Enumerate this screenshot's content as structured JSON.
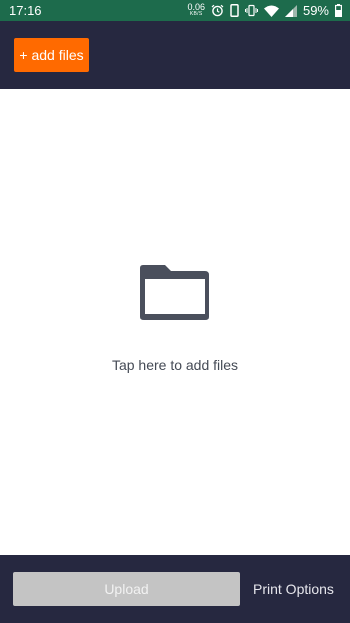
{
  "status_bar": {
    "time": "17:16",
    "net_speed_value": "0.06",
    "net_speed_unit": "KB/S",
    "battery_percent": "59%",
    "icons": [
      "alarm-icon",
      "phone-icon",
      "vibrate-icon",
      "wifi-icon",
      "signal-icon",
      "battery-icon"
    ]
  },
  "header": {
    "add_files_label": "+ add files",
    "accent_color": "#ff6a00",
    "bar_color": "#262840"
  },
  "main": {
    "icon": "folder-icon",
    "hint": "Tap here to add files"
  },
  "footer": {
    "upload_label": "Upload",
    "print_options_label": "Print Options"
  }
}
